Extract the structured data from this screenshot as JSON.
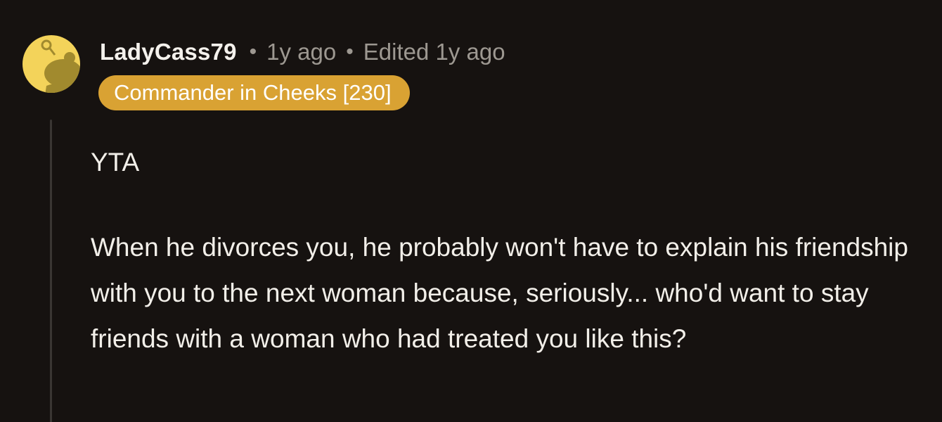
{
  "comment": {
    "author": "LadyCass79",
    "separator": "•",
    "posted": "1y ago",
    "edited": "Edited 1y ago",
    "flair": "Commander in Cheeks [230]",
    "body": [
      "YTA",
      "When he divorces you, he probably won't have to explain his friendship with you to the next woman because, seriously... who'd want to stay friends with a woman who had treated you like this?"
    ]
  },
  "colors": {
    "background": "#161210",
    "flair_background": "#d9a233",
    "avatar_background": "#f3d35a",
    "meta_text": "#9d9891"
  },
  "icons": {
    "avatar": "snoo-avatar-icon"
  }
}
